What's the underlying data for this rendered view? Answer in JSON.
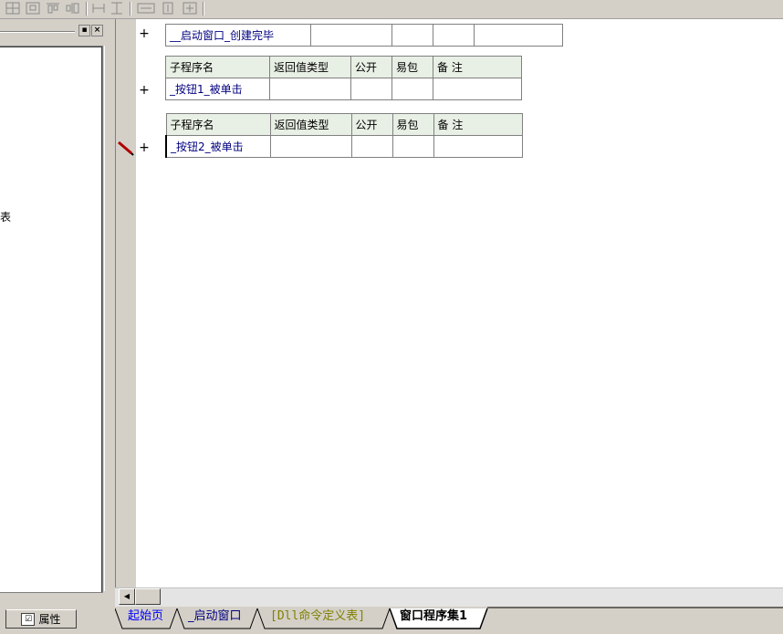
{
  "toolbar": {
    "icons": [
      "align-left-icon",
      "align-center-icon",
      "align-top-icon",
      "align-bottom-icon",
      "same-width-icon",
      "same-height-icon",
      "h-space-icon",
      "v-space-icon",
      "center-icon"
    ]
  },
  "left_panel": {
    "tree_partial_text": "表",
    "property_tab_label": "属性"
  },
  "editor": {
    "row1": {
      "name": "__启动窗口_创建完毕"
    },
    "header": {
      "col1": "子程序名",
      "col2": "返回值类型",
      "col3": "公开",
      "col4": "易包",
      "col5": "备 注"
    },
    "row2": {
      "name": "_按钮1_被单击"
    },
    "row3": {
      "name": "_按钮2_被单击"
    }
  },
  "tabs": {
    "items": [
      {
        "label": "起始页",
        "color": "#0000ff"
      },
      {
        "label": "_启动窗口",
        "color": "#000080"
      },
      {
        "label": "[Dll命令定义表]",
        "color": "#808000"
      },
      {
        "label": "窗口程序集1",
        "color": "#000000",
        "active": true
      }
    ]
  },
  "colors": {
    "background": "#d4d0c8",
    "header_cell": "#e8efe4",
    "name_text": "#000080"
  }
}
